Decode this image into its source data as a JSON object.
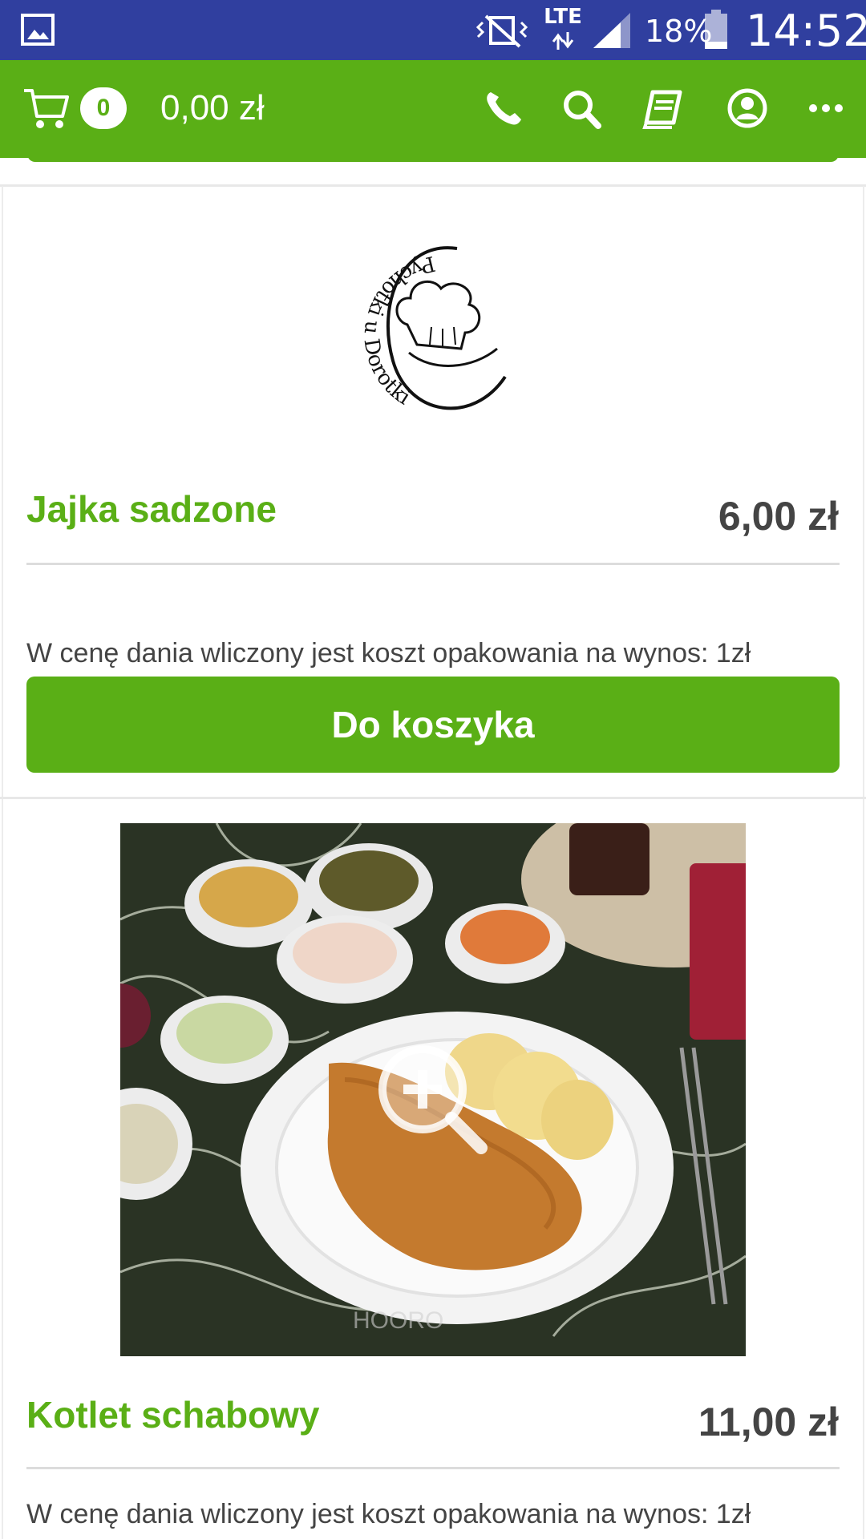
{
  "status_bar": {
    "network": "LTE",
    "battery_percent": "18%",
    "time": "14:52",
    "icons": [
      "gallery-icon",
      "vibrate-icon",
      "signal-icon",
      "battery-icon"
    ]
  },
  "app_bar": {
    "cart_count": "0",
    "cart_total": "0,00 zł",
    "icons": [
      "cart-icon",
      "phone-icon",
      "search-icon",
      "menu-book-icon",
      "account-icon",
      "more-icon"
    ],
    "accent_color": "#5aaf16",
    "status_color": "#303f9f"
  },
  "items": [
    {
      "title": "Jajka sadzone",
      "price": "6,00 zł",
      "note": "W cenę dania wliczony jest koszt opakowania na wynos: 1zł",
      "button_label": "Do koszyka",
      "image": "restaurant-logo"
    },
    {
      "title": "Kotlet schabowy",
      "price": "11,00 zł",
      "note": "W cenę dania wliczony jest koszt opakowania na wynos: 1zł",
      "image": "food-photo"
    }
  ],
  "logo": {
    "text": "Pychotki u Dorotki"
  },
  "photo": {
    "watermark": "HOORO"
  }
}
